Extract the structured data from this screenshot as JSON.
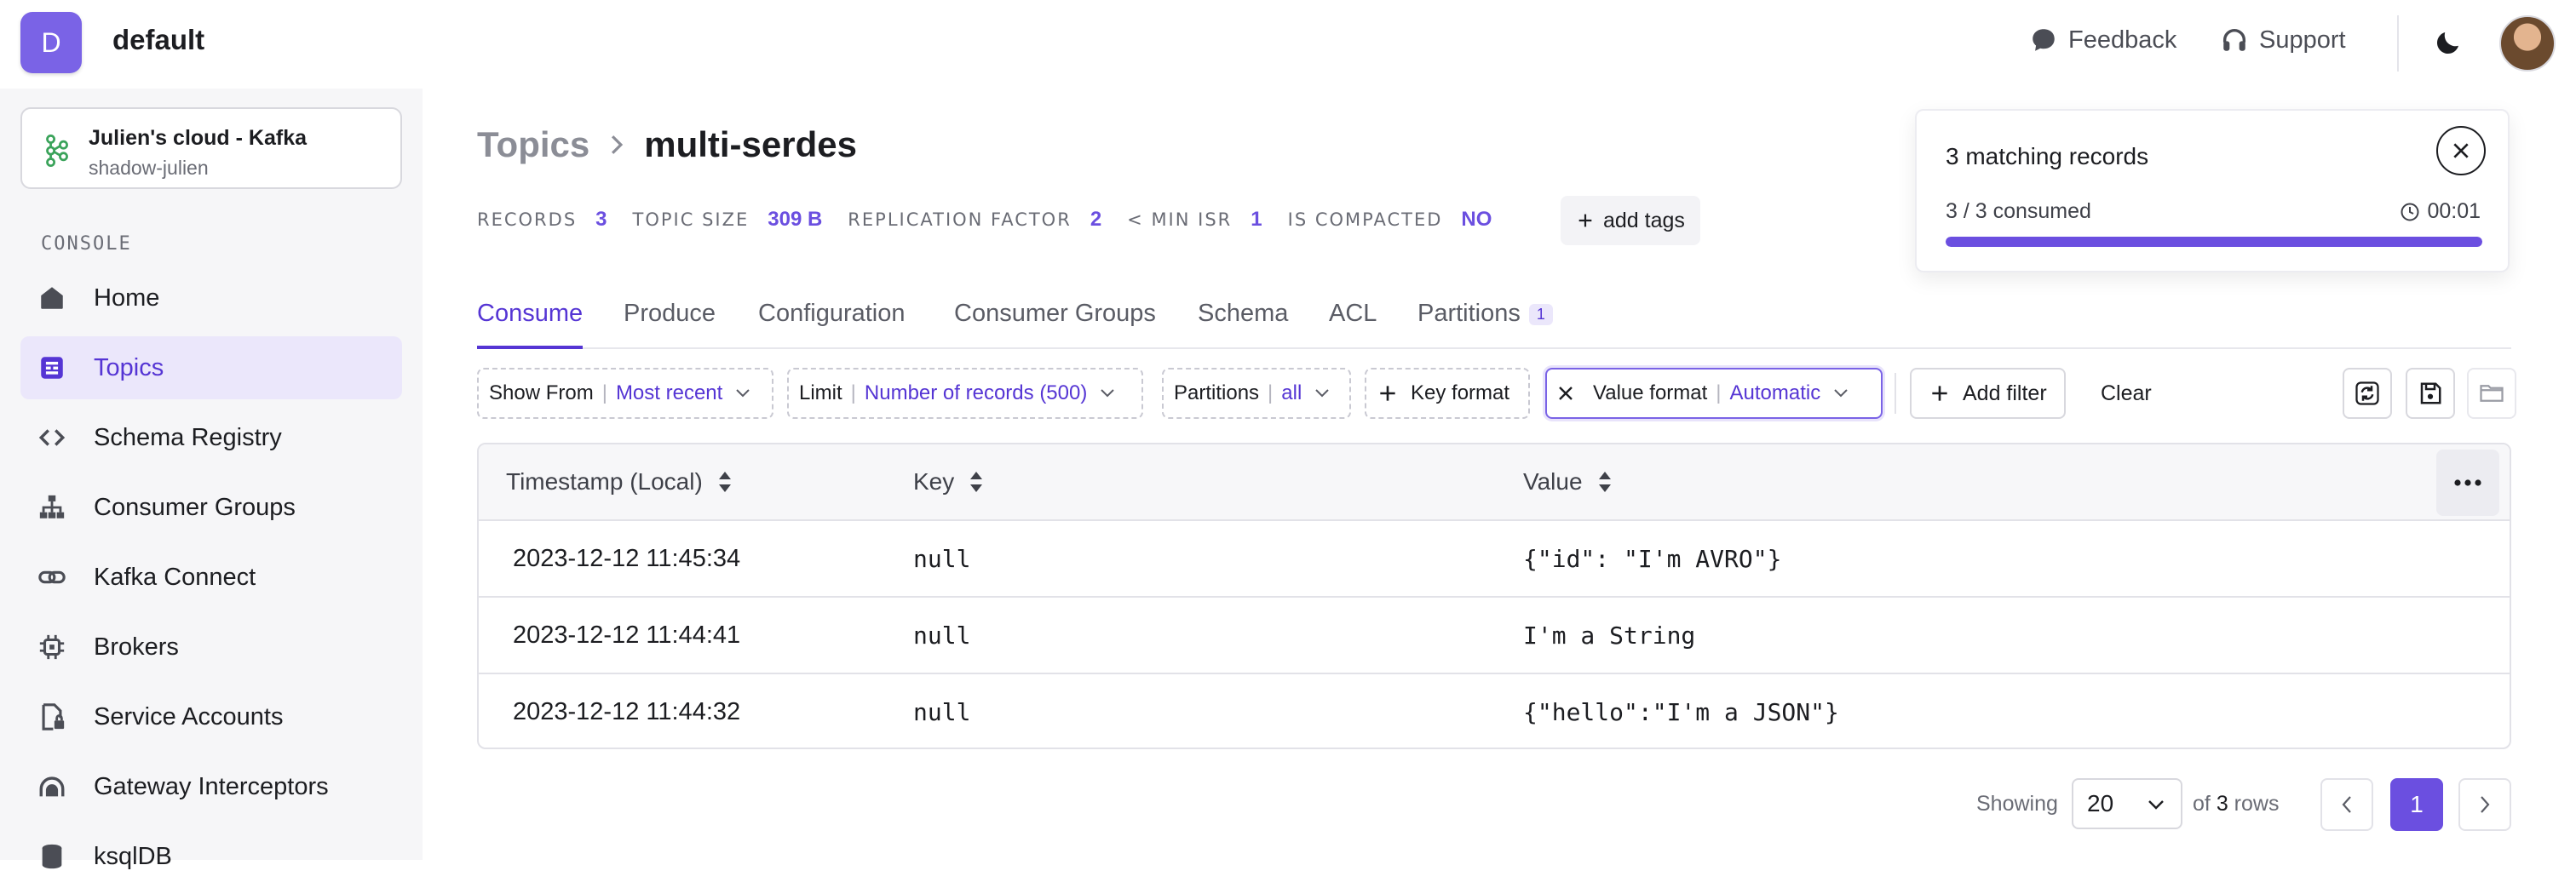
{
  "org": {
    "initial": "D",
    "name": "default"
  },
  "header": {
    "feedback_label": "Feedback",
    "support_label": "Support"
  },
  "cluster": {
    "name": "Julien's cloud - Kafka",
    "sub": "shadow-julien"
  },
  "sidebar": {
    "section": "CONSOLE",
    "items": [
      {
        "label": "Home",
        "icon": "home-icon"
      },
      {
        "label": "Topics",
        "icon": "topics-icon",
        "active": true
      },
      {
        "label": "Schema Registry",
        "icon": "code-icon"
      },
      {
        "label": "Consumer Groups",
        "icon": "hierarchy-icon"
      },
      {
        "label": "Kafka Connect",
        "icon": "link-icon"
      },
      {
        "label": "Brokers",
        "icon": "chip-icon"
      },
      {
        "label": "Service Accounts",
        "icon": "file-lock-icon"
      },
      {
        "label": "Gateway Interceptors",
        "icon": "gateway-icon"
      },
      {
        "label": "ksqlDB",
        "icon": "database-icon"
      }
    ]
  },
  "breadcrumb": {
    "root": "Topics",
    "current": "multi-serdes"
  },
  "stats": {
    "records_label": "RECORDS",
    "records_value": "3",
    "size_label": "TOPIC SIZE",
    "size_value": "309 B",
    "replication_label": "REPLICATION FACTOR",
    "replication_value": "2",
    "min_isr_label": "< MIN ISR",
    "min_isr_value": "1",
    "compacted_label": "IS COMPACTED",
    "compacted_value": "NO",
    "add_tags_label": "add tags"
  },
  "tabs": [
    {
      "label": "Consume",
      "active": true
    },
    {
      "label": "Produce"
    },
    {
      "label": "Configuration"
    },
    {
      "label": "Consumer Groups"
    },
    {
      "label": "Schema"
    },
    {
      "label": "ACL"
    },
    {
      "label": "Partitions",
      "badge": "1"
    }
  ],
  "filters": {
    "show_from_label": "Show From",
    "show_from_value": "Most recent",
    "limit_label": "Limit",
    "limit_value": "Number of records (500)",
    "partitions_label": "Partitions",
    "partitions_value": "all",
    "key_format_label": "Key format",
    "value_format_label": "Value format",
    "value_format_value": "Automatic",
    "add_filter_label": "Add filter",
    "clear_label": "Clear"
  },
  "table": {
    "columns": [
      "Timestamp (Local)",
      "Key",
      "Value"
    ],
    "rows": [
      {
        "timestamp": "2023-12-12 11:45:34",
        "key": "null",
        "value": "{\"id\": \"I'm AVRO\"}"
      },
      {
        "timestamp": "2023-12-12 11:44:41",
        "key": "null",
        "value": "I'm a String"
      },
      {
        "timestamp": "2023-12-12 11:44:32",
        "key": "null",
        "value": "{\"hello\":\"I'm a JSON\"}"
      }
    ]
  },
  "pagination": {
    "showing_label": "Showing",
    "page_size": "20",
    "of_label": "of",
    "total": "3",
    "rows_label": "rows",
    "current_page": "1"
  },
  "toast": {
    "title": "3 matching records",
    "progress_label": "3 / 3 consumed",
    "elapsed": "00:01",
    "progress": 1.0
  },
  "colors": {
    "accent": "#6b4fe0",
    "org_avatar": "#7a63e6",
    "active_bg": "#ebe7fb"
  }
}
